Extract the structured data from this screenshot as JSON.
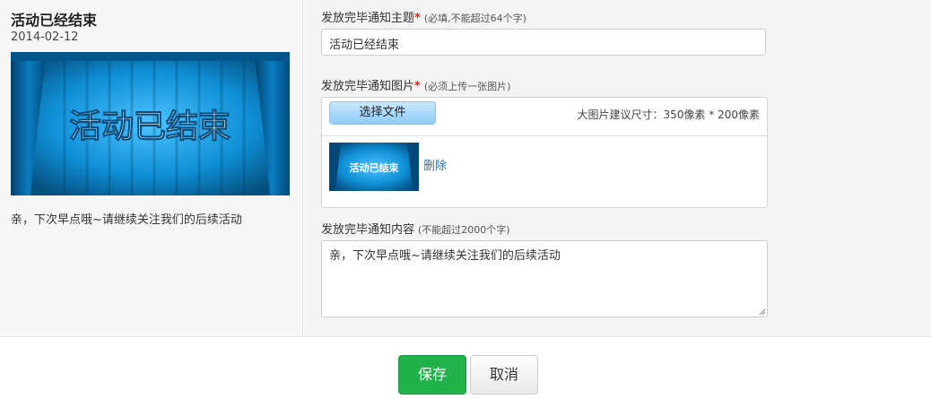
{
  "preview": {
    "title": "活动已经结束",
    "date": "2014-02-12",
    "banner_text": "活动已结束",
    "body": "亲，下次早点哦~请继续关注我们的后续活动"
  },
  "form": {
    "subject": {
      "label": "发放完毕通知主题",
      "required_mark": "*",
      "hint": "(必填,不能超过64个字)",
      "value": "活动已经结束"
    },
    "image": {
      "label": "发放完毕通知图片",
      "required_mark": "*",
      "hint": "(必须上传一张图片)",
      "choose_label": "选择文件",
      "size_hint": "大图片建议尺寸：350像素 * 200像素",
      "thumb_text": "活动已结束",
      "delete_label": "删除"
    },
    "content": {
      "label": "发放完毕通知内容",
      "hint": "(不能超过2000个字)",
      "value": "亲，下次早点哦~请继续关注我们的后续活动"
    }
  },
  "footer": {
    "save_label": "保存",
    "cancel_label": "取消"
  },
  "colors": {
    "save": "#22b24a",
    "required": "#e02020",
    "link": "#2a73b8",
    "banner_blue": "#1aa0e0"
  }
}
